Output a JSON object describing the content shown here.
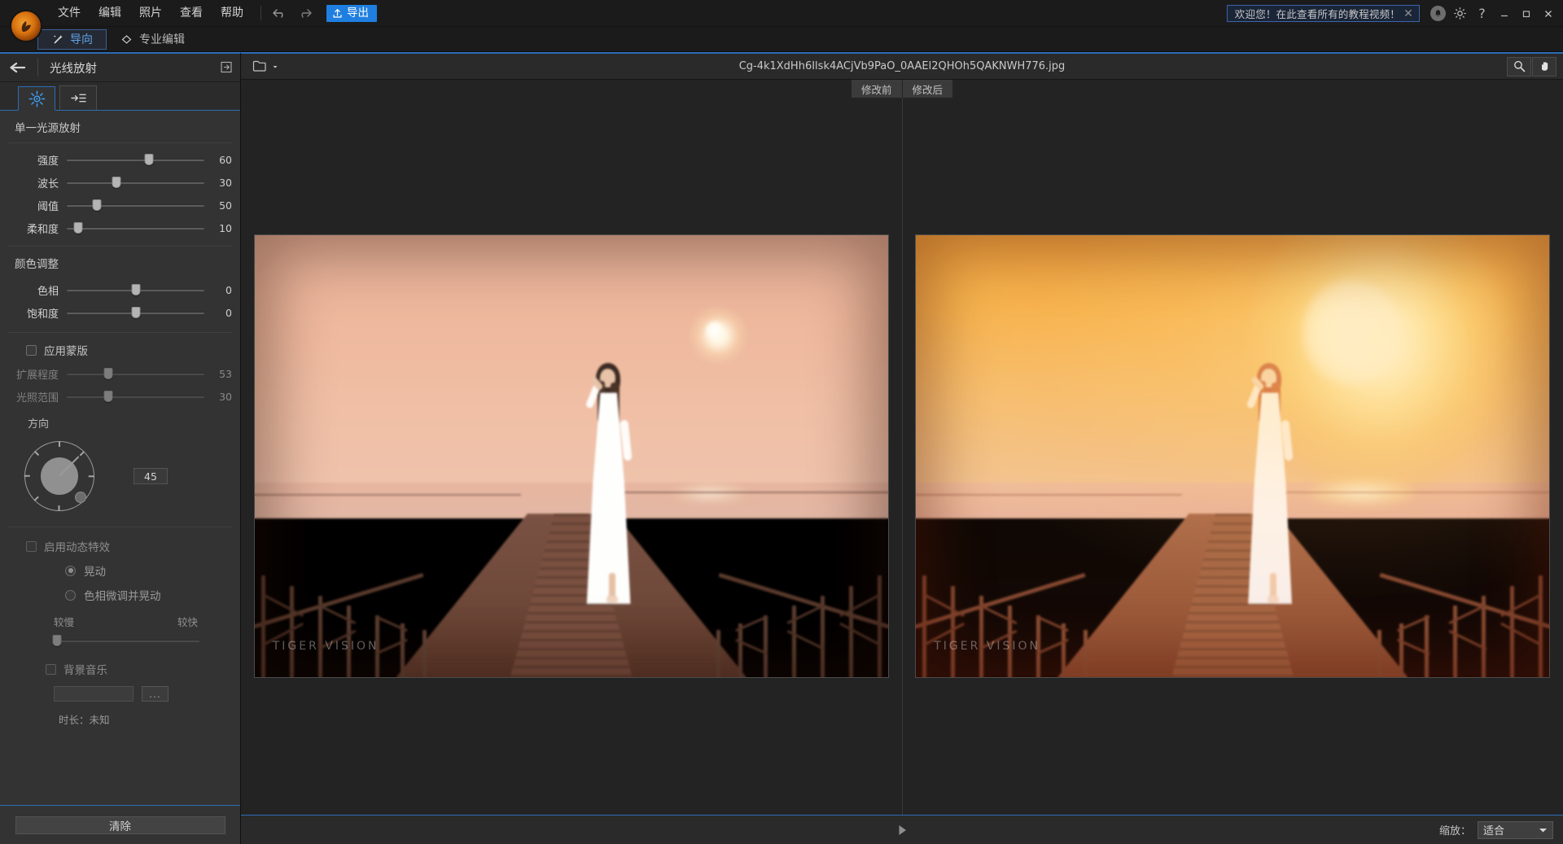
{
  "titlebar": {
    "menus": [
      "文件",
      "编辑",
      "照片",
      "查看",
      "帮助"
    ],
    "undo_icon": "undo-arrow-icon",
    "redo_icon": "redo-arrow-icon",
    "export_label": "导出",
    "export_icon": "upload-icon",
    "notice_text": "欢迎您！在此查看所有的教程视频！",
    "notice_close_icon": "close-icon",
    "bell_icon": "bell-icon",
    "gear_icon": "gear-icon",
    "help_label": "?",
    "minimize_icon": "minimize-icon",
    "maximize_icon": "maximize-icon",
    "close_icon": "close-icon",
    "accent_blue": "#1f7fe0"
  },
  "modebar": {
    "guided_label": "导向",
    "guided_icon": "magic-wand-icon",
    "expert_label": "专业编辑",
    "expert_icon": "layers-diamond-icon"
  },
  "left_panel": {
    "back_icon": "back-arrow-icon",
    "title": "光线放射",
    "head_tool_icon": "preset-save-icon",
    "tabs": [
      {
        "name": "single-light-tab",
        "icon": "sunburst-icon",
        "active": true
      },
      {
        "name": "light-rays-tab",
        "icon": "rays-lines-icon",
        "active": false
      }
    ],
    "section_single": "单一光源放射",
    "sliders_single": [
      {
        "label": "强度",
        "value": 60,
        "pct": 60
      },
      {
        "label": "波长",
        "value": 30,
        "pct": 30
      },
      {
        "label": "阈值",
        "value": 50,
        "pct": 22
      },
      {
        "label": "柔和度",
        "value": 10,
        "pct": 8
      }
    ],
    "section_color": "颜色调整",
    "sliders_color": [
      {
        "label": "色相",
        "value": 0,
        "pct": 50
      },
      {
        "label": "饱和度",
        "value": 0,
        "pct": 50
      }
    ],
    "mask_checkbox": {
      "label": "应用蒙版",
      "checked": false
    },
    "sliders_mask": [
      {
        "label": "扩展程度",
        "value": 53,
        "pct": 30
      },
      {
        "label": "光照范围",
        "value": 30,
        "pct": 30
      }
    ],
    "direction_label": "方向",
    "direction_value": 45,
    "dynamic_checkbox": {
      "label": "启用动态特效",
      "checked": false
    },
    "radios": [
      {
        "label": "晃动",
        "selected": true
      },
      {
        "label": "色相微调并晃动",
        "selected": false
      }
    ],
    "speed_slow": "较慢",
    "speed_fast": "较快",
    "speed_pct": 2,
    "music_checkbox": {
      "label": "背景音乐",
      "checked": false
    },
    "music_path": "",
    "music_browse_label": "...",
    "duration_label": "时长：未知",
    "clear_label": "清除"
  },
  "filebar": {
    "folder_icon": "folder-open-icon",
    "filename": "Cg-4k1XdHh6Ilsk4ACjVb9PaO_0AAEl2QHOh5QAKNWH776.jpg",
    "zoom_tool_icon": "magnifier-icon",
    "hand_tool_icon": "hand-icon"
  },
  "compare": {
    "before_label": "修改前",
    "after_label": "修改后"
  },
  "canvas": {
    "before_watermark": "TIGER VISION",
    "after_watermark": "TIGER VISION"
  },
  "bottombar": {
    "play_icon": "play-icon",
    "zoom_label": "缩放：",
    "zoom_value": "适合",
    "chevron_icon": "chevron-down-icon"
  }
}
